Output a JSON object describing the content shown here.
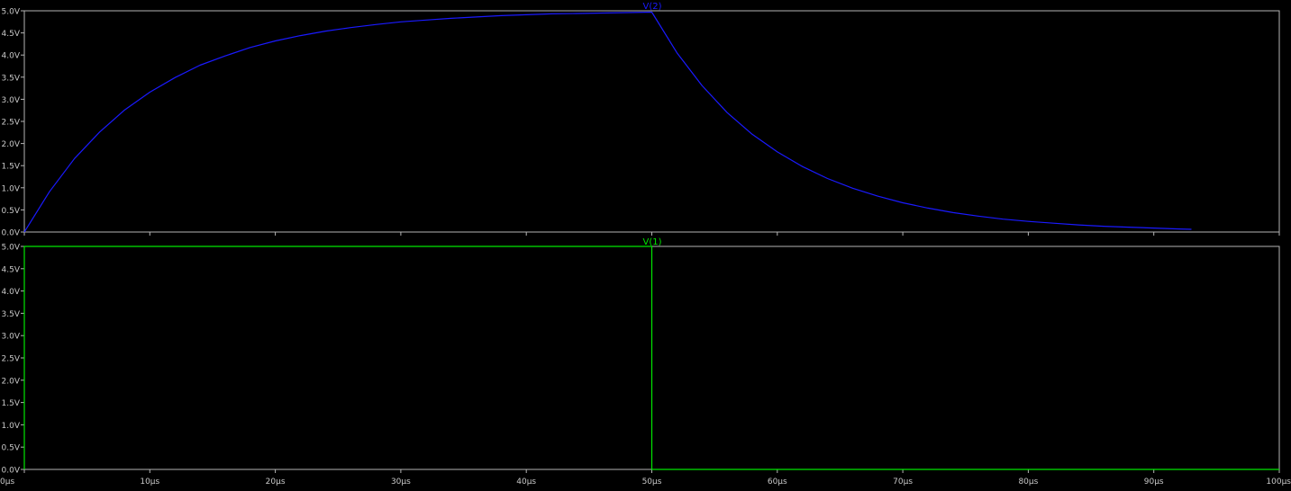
{
  "chart_data": [
    {
      "type": "line",
      "trace_label": "V(2)",
      "x_unit": "µs",
      "y_unit": "V",
      "xlim": [
        0,
        100
      ],
      "ylim": [
        0,
        5
      ],
      "x_ticks": [
        "0µs",
        "10µs",
        "20µs",
        "30µs",
        "40µs",
        "50µs",
        "60µs",
        "70µs",
        "80µs",
        "90µs",
        "100µs"
      ],
      "y_ticks": [
        "0.0V",
        "0.5V",
        "1.0V",
        "1.5V",
        "2.0V",
        "2.5V",
        "3.0V",
        "3.5V",
        "4.0V",
        "4.5V",
        "5.0V"
      ],
      "grid": false,
      "colors": {
        "trace": "#1a1aff",
        "frame": "#b4b4b4",
        "text": "#c8c8c8"
      },
      "series": [
        {
          "name": "V(2)",
          "x": [
            0,
            2,
            4,
            6,
            8,
            10,
            12,
            14,
            16,
            18,
            20,
            22,
            24,
            26,
            28,
            30,
            32,
            34,
            36,
            38,
            40,
            42,
            44,
            46,
            48,
            50,
            52,
            54,
            56,
            58,
            60,
            62,
            64,
            66,
            68,
            70,
            72,
            74,
            76,
            78,
            80,
            82,
            84,
            86,
            88,
            90,
            92,
            93
          ],
          "y": [
            0.0,
            0.91,
            1.66,
            2.26,
            2.76,
            3.16,
            3.49,
            3.77,
            3.98,
            4.17,
            4.32,
            4.44,
            4.54,
            4.62,
            4.69,
            4.75,
            4.79,
            4.83,
            4.86,
            4.89,
            4.91,
            4.93,
            4.94,
            4.95,
            4.96,
            4.97,
            4.05,
            3.31,
            2.7,
            2.21,
            1.81,
            1.48,
            1.21,
            0.99,
            0.81,
            0.66,
            0.54,
            0.44,
            0.36,
            0.29,
            0.24,
            0.2,
            0.16,
            0.13,
            0.11,
            0.09,
            0.07,
            0.06
          ]
        }
      ]
    },
    {
      "type": "line",
      "trace_label": "V(1)",
      "x_unit": "µs",
      "y_unit": "V",
      "xlim": [
        0,
        100
      ],
      "ylim": [
        0,
        5
      ],
      "x_ticks": [
        "0µs",
        "10µs",
        "20µs",
        "30µs",
        "40µs",
        "50µs",
        "60µs",
        "70µs",
        "80µs",
        "90µs",
        "100µs"
      ],
      "y_ticks": [
        "0.0V",
        "0.5V",
        "1.0V",
        "1.5V",
        "2.0V",
        "2.5V",
        "3.0V",
        "3.5V",
        "4.0V",
        "4.5V",
        "5.0V"
      ],
      "grid": false,
      "colors": {
        "trace": "#00e600",
        "frame": "#b4b4b4",
        "text": "#c8c8c8"
      },
      "series": [
        {
          "name": "V(1)",
          "x": [
            0,
            0,
            50,
            50,
            100
          ],
          "y": [
            0,
            5,
            5,
            0,
            0
          ]
        }
      ]
    }
  ]
}
